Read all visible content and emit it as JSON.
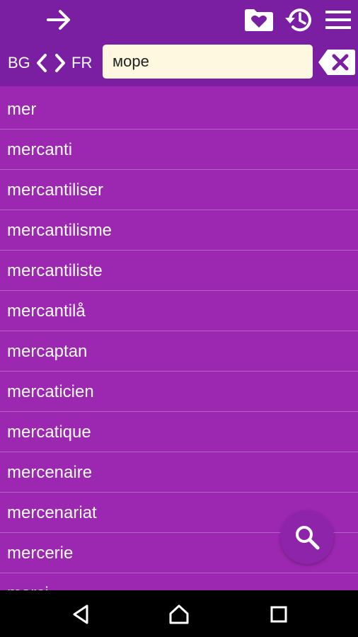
{
  "header": {
    "source_lang": "BG",
    "target_lang": "FR",
    "search": {
      "value": "море",
      "placeholder": ""
    }
  },
  "icons": {
    "forward": "arrow-right-icon",
    "favorites": "heart-folder-icon",
    "history": "history-clock-icon",
    "menu": "hamburger-menu-icon",
    "swap": "swap-languages-icon",
    "clear": "backspace-clear-icon",
    "search": "search-icon"
  },
  "results": [
    "mer",
    "mercanti",
    "mercantiliser",
    "mercantilisme",
    "mercantiliste",
    "mercantilå",
    "mercaptan",
    "mercaticien",
    "mercatique",
    "mercenaire",
    "mercenariat",
    "mercerie",
    "merci"
  ],
  "colors": {
    "header": "#7b1fa2",
    "list": "#9c27b0",
    "search_bg": "#fff8e1",
    "fab": "#8e24aa"
  }
}
